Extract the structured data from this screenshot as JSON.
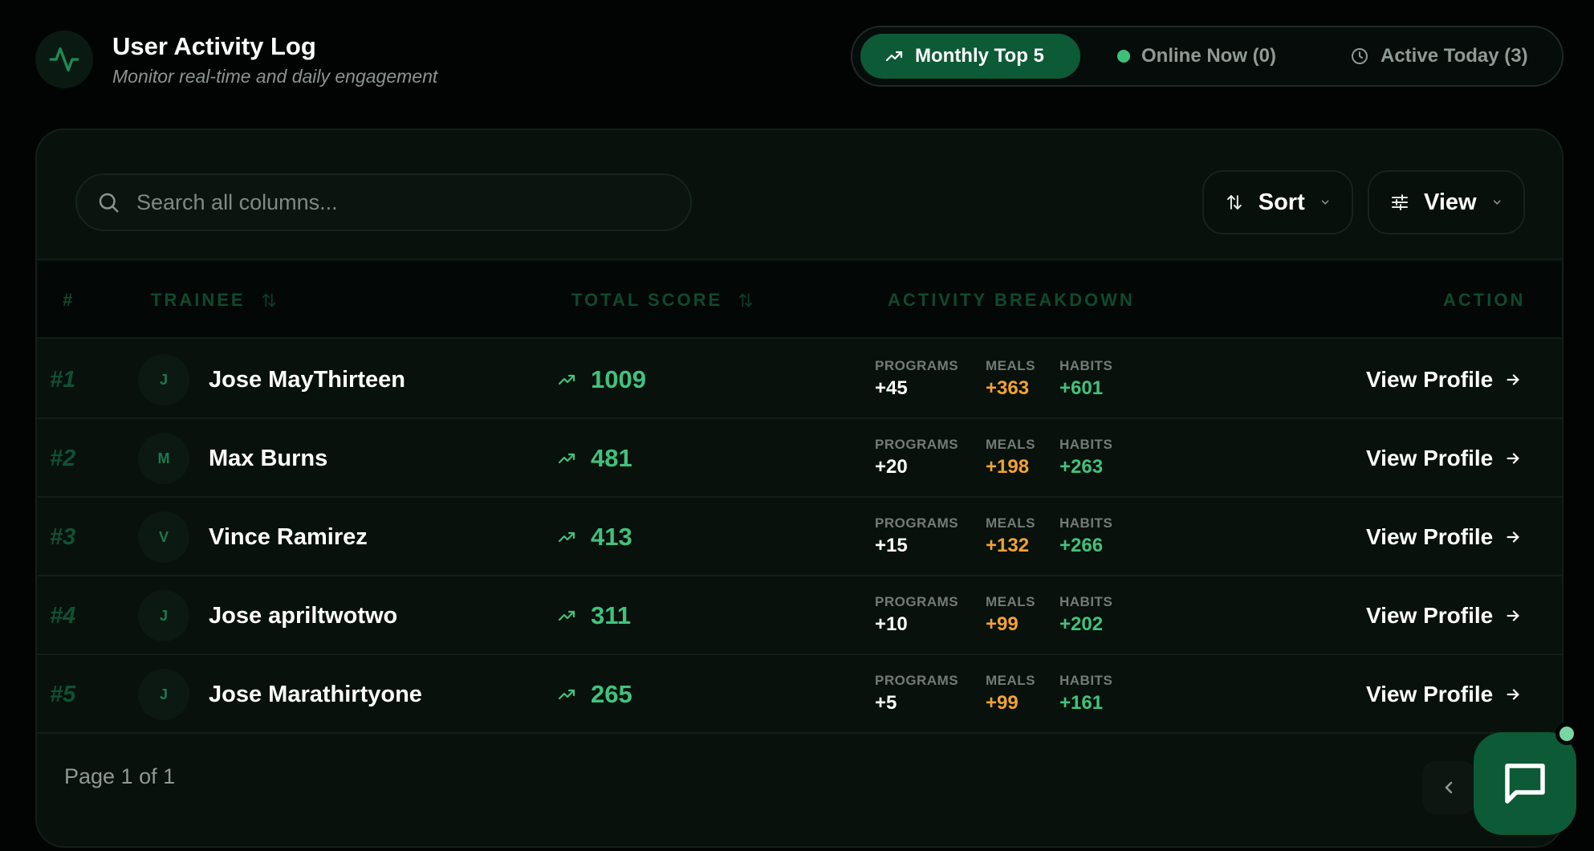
{
  "header": {
    "title": "User Activity Log",
    "subtitle": "Monitor real-time and daily engagement",
    "logo_icon": "activity-pulse-icon"
  },
  "tabs": [
    {
      "label": "Monthly Top 5",
      "icon": "trending-up-icon",
      "active": true
    },
    {
      "label": "Online Now (0)",
      "icon": "status-dot-icon",
      "active": false
    },
    {
      "label": "Active Today (3)",
      "icon": "clock-icon",
      "active": false
    }
  ],
  "toolbar": {
    "search_placeholder": "Search all columns...",
    "sort_label": "Sort",
    "view_label": "View"
  },
  "table": {
    "columns": {
      "rank": "#",
      "trainee": "TRAINEE",
      "total_score": "TOTAL SCORE",
      "activity": "ACTIVITY BREAKDOWN",
      "action": "ACTION"
    },
    "metric_labels": {
      "programs": "PROGRAMS",
      "meals": "MEALS",
      "habits": "HABITS"
    },
    "action_label": "View Profile",
    "rows": [
      {
        "rank": "#1",
        "initial": "J",
        "name": "Jose MayThirteen",
        "score": "1009",
        "programs": "+45",
        "meals": "+363",
        "habits": "+601"
      },
      {
        "rank": "#2",
        "initial": "M",
        "name": "Max Burns",
        "score": "481",
        "programs": "+20",
        "meals": "+198",
        "habits": "+263"
      },
      {
        "rank": "#3",
        "initial": "V",
        "name": "Vince Ramirez",
        "score": "413",
        "programs": "+15",
        "meals": "+132",
        "habits": "+266"
      },
      {
        "rank": "#4",
        "initial": "J",
        "name": "Jose apriltwotwo",
        "score": "311",
        "programs": "+10",
        "meals": "+99",
        "habits": "+202"
      },
      {
        "rank": "#5",
        "initial": "J",
        "name": "Jose Marathirtyone",
        "score": "265",
        "programs": "+5",
        "meals": "+99",
        "habits": "+161"
      }
    ]
  },
  "footer": {
    "page_info": "Page 1 of 1"
  },
  "colors": {
    "accent": "#0d5a36",
    "score_green": "#41c27d",
    "meals_orange": "#f2a232",
    "background": "#020403"
  }
}
